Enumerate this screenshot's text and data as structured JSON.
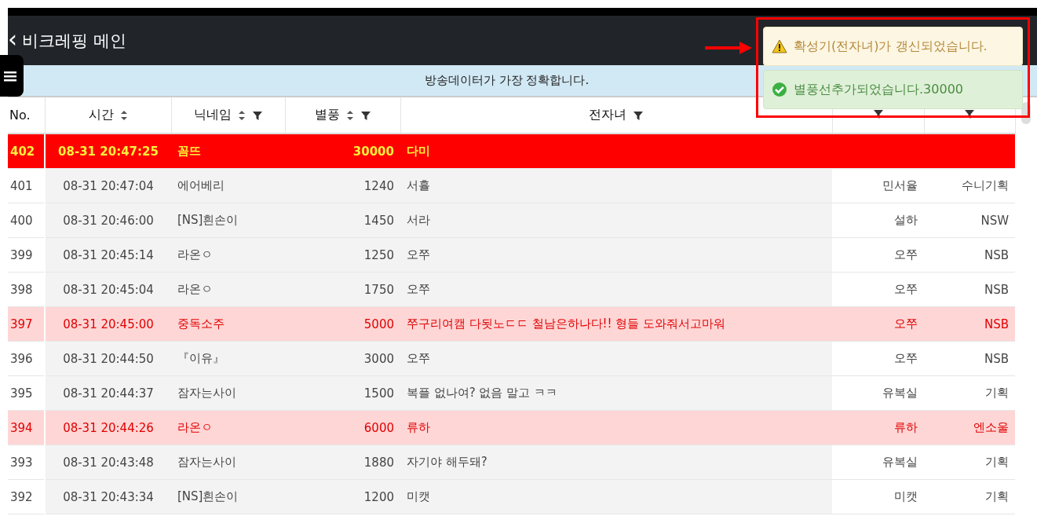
{
  "header": {
    "back_icon": "‹",
    "title": "비크레핑 메인"
  },
  "banner": {
    "text": "방송데이터가 가장 정확합니다."
  },
  "table": {
    "columns": [
      {
        "label": "No."
      },
      {
        "label": "시간",
        "sortable": true
      },
      {
        "label": "닉네임",
        "sortable": true,
        "filter": true
      },
      {
        "label": "별풍",
        "sortable": true,
        "filter": true
      },
      {
        "label": "전자녀",
        "filter": true
      },
      {
        "filter": true
      },
      {
        "filter": true
      }
    ],
    "rows": [
      {
        "kind": "new",
        "cells": [
          "402",
          "08-31 20:47:25",
          "꼼뜨",
          "30000",
          "다미",
          "",
          ""
        ]
      },
      {
        "kind": "normal",
        "cells": [
          "401",
          "08-31 20:47:04",
          "에어베리",
          "1240",
          "서휼",
          "민서율",
          "수니기획"
        ]
      },
      {
        "kind": "normal",
        "cells": [
          "400",
          "08-31 20:46:00",
          "[NS]흰손이",
          "1450",
          "서라",
          "설하",
          "NSW"
        ]
      },
      {
        "kind": "normal",
        "cells": [
          "399",
          "08-31 20:45:14",
          "라온ㅇ",
          "1250",
          "오쭈",
          "오쭈",
          "NSB"
        ]
      },
      {
        "kind": "normal",
        "cells": [
          "398",
          "08-31 20:45:04",
          "라온ㅇ",
          "1750",
          "오쭈",
          "오쭈",
          "NSB"
        ]
      },
      {
        "kind": "big",
        "cells": [
          "397",
          "08-31 20:45:00",
          "중독소주",
          "5000",
          "쭈구리여캠 다됫노ㄷㄷ 철남은하나다!! 형들 도와줘서고마워",
          "오쭈",
          "NSB"
        ]
      },
      {
        "kind": "normal",
        "cells": [
          "396",
          "08-31 20:44:50",
          "『이유』",
          "3000",
          "오쭈",
          "오쭈",
          "NSB"
        ]
      },
      {
        "kind": "normal",
        "cells": [
          "395",
          "08-31 20:44:37",
          "잠자는사이",
          "1500",
          "복플 없나여? 없음 말고 ㅋㅋ",
          "유복실",
          "기획"
        ]
      },
      {
        "kind": "big",
        "cells": [
          "394",
          "08-31 20:44:26",
          "라온ㅇ",
          "6000",
          "류하",
          "류하",
          "엔소울"
        ]
      },
      {
        "kind": "normal",
        "cells": [
          "393",
          "08-31 20:43:48",
          "잠자는사이",
          "1880",
          "자기야 해두돼?",
          "유복실",
          "기획"
        ]
      },
      {
        "kind": "normal",
        "cells": [
          "392",
          "08-31 20:43:34",
          "[NS]흰손이",
          "1200",
          "미캣",
          "미캣",
          "기획"
        ]
      }
    ]
  },
  "toasts": [
    {
      "kind": "warning",
      "text": "확성기(전자녀)가 갱신되었습니다."
    },
    {
      "kind": "success",
      "text": "별풍선추가되었습니다.30000"
    }
  ]
}
